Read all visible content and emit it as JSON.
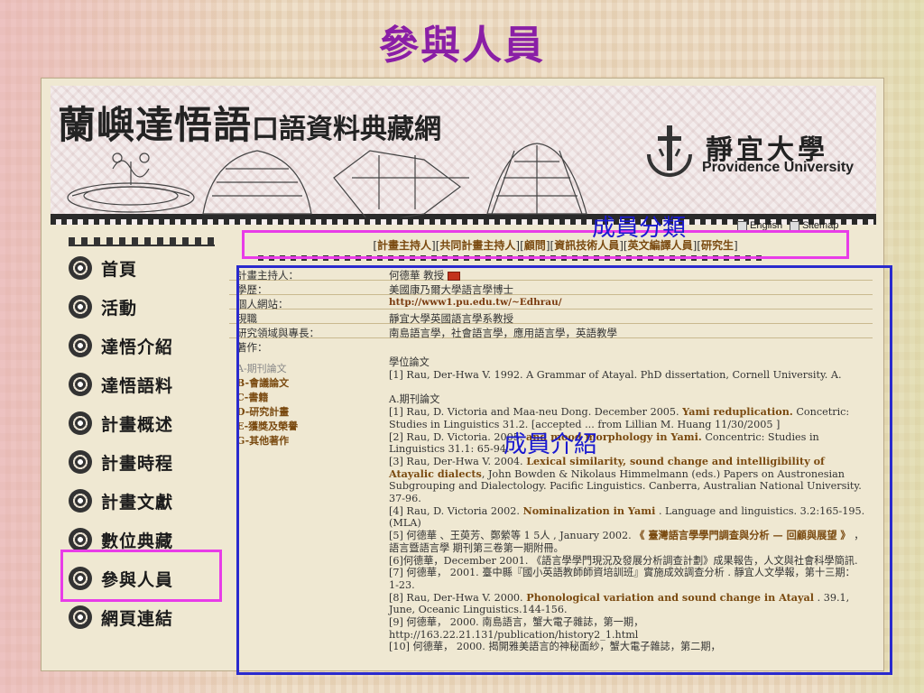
{
  "slide": {
    "title": "參與人員"
  },
  "site": {
    "title_big": "蘭嶼達悟語",
    "title_small": "口語資料典藏網",
    "university_cn": "靜宜大學",
    "university_en": "Providence University"
  },
  "toplinks": [
    {
      "label": "English",
      "icon": "language-icon"
    },
    {
      "label": "Sitemap",
      "icon": "sitemap-icon"
    }
  ],
  "category_nav": [
    "計畫主持人",
    "共同計畫主持人",
    "顧問",
    "資訊技術人員",
    "英文編譯人員",
    "研究生"
  ],
  "left_nav": [
    {
      "label": "首頁"
    },
    {
      "label": "活動"
    },
    {
      "label": "達悟介紹"
    },
    {
      "label": "達悟語料"
    },
    {
      "label": "計畫概述"
    },
    {
      "label": "計畫時程"
    },
    {
      "label": "計畫文獻"
    },
    {
      "label": "數位典藏"
    },
    {
      "label": "參與人員"
    },
    {
      "label": "網頁連結"
    }
  ],
  "profile": {
    "pi_label": "計畫主持人：",
    "pi_value": "何德華 教授",
    "edu_label": "學歷：",
    "edu_value": "美國康乃爾大學語言學博士",
    "web_label": "個人網站：",
    "web_value": "http://www1.pu.edu.tw/~Edhrau/",
    "job_label": "現職",
    "job_value": "靜宜大學英國語言學系教授",
    "field_label": "研究領域與專長：",
    "field_value": "南島語言學，社會語言學，應用語言學，英語教學",
    "works_label": "著作："
  },
  "works_nav": [
    "A-期刊論文",
    "B-會議論文",
    "C-書籍",
    "D-研究計畫",
    "E-獲獎及榮譽",
    "G-其他著作"
  ],
  "publications": {
    "thesis_heading": "學位論文",
    "thesis_1": "[1] Rau, Der-Hwa V. 1992. A Grammar of Atayal. PhD dissertation, Cornell University. A.",
    "journal_heading": "A.期刊論文",
    "j1_a": "[1] Rau, D. Victoria and Maa-neu Dong. December 2005.",
    "j1_b": "Yami reduplication.",
    "j1_c": "Concetric: Studies in Linguistics 31.2. [accepted ... from Lillian M. Huang 11/30/2005 ]",
    "j2_a": "[2] Rau, D. Victoria. 2005.",
    "j2_b": "and mood morphology in Yami.",
    "j2_c": "Concentric: Studies in Linguistics 31.1: 65-94.",
    "j3_a": "[3] Rau, Der-Hwa V. 2004.",
    "j3_b": "Lexical similarity, sound change and intelligibility of Atayalic dialects",
    "j3_c": ", John Bowden & Nikolaus Himmelmann (eds.) Papers on Austronesian Subgrouping and Dialectology. Pacific Linguistics. Canberra, Australian National University. 37-96.",
    "j4_a": "[4] Rau, D. Victoria 2002.",
    "j4_b": "Nominalization in Yami",
    "j4_c": ". Language and linguistics. 3.2:165-195.(MLA)",
    "j5_a": "[5] 何德華 、王萸芳、鄭縈等 1 5人 , January 2002.",
    "j5_b": "《 臺灣語言學學門調查與分析 — 回顧與展望 》",
    "j5_c": "， 語言暨語言學 期刊第三卷第一期附冊。",
    "j6": "[6]何德華，December 2001. 《語言學學門現況及發展分析調查計劃》成果報告，人文與社會科學簡訊.",
    "j7": "[7] 何德華， 2001. 臺中縣『國小英語教師師資培訓班』實施成效調查分析 . 靜宜人文學報，第十三期： 1-23.",
    "j8_a": "[8] Rau, Der-Hwa V. 2000.",
    "j8_b": "Phonological variation and sound change in Atayal",
    "j8_c": ". 39.1, June, Oceanic Linguistics.144-156.",
    "j9": "[9] 何德華， 2000. 南島語言，蟹大電子雜誌，第一期，",
    "j9_url": "http://163.22.21.131/publication/history2_1.html",
    "j10": "[10] 何德華， 2000. 揭開雅美語言的神秘面紗，蟹大電子雜誌，第二期，"
  },
  "annotations": {
    "category_label": "成員分類",
    "member_label": "成員介紹"
  }
}
